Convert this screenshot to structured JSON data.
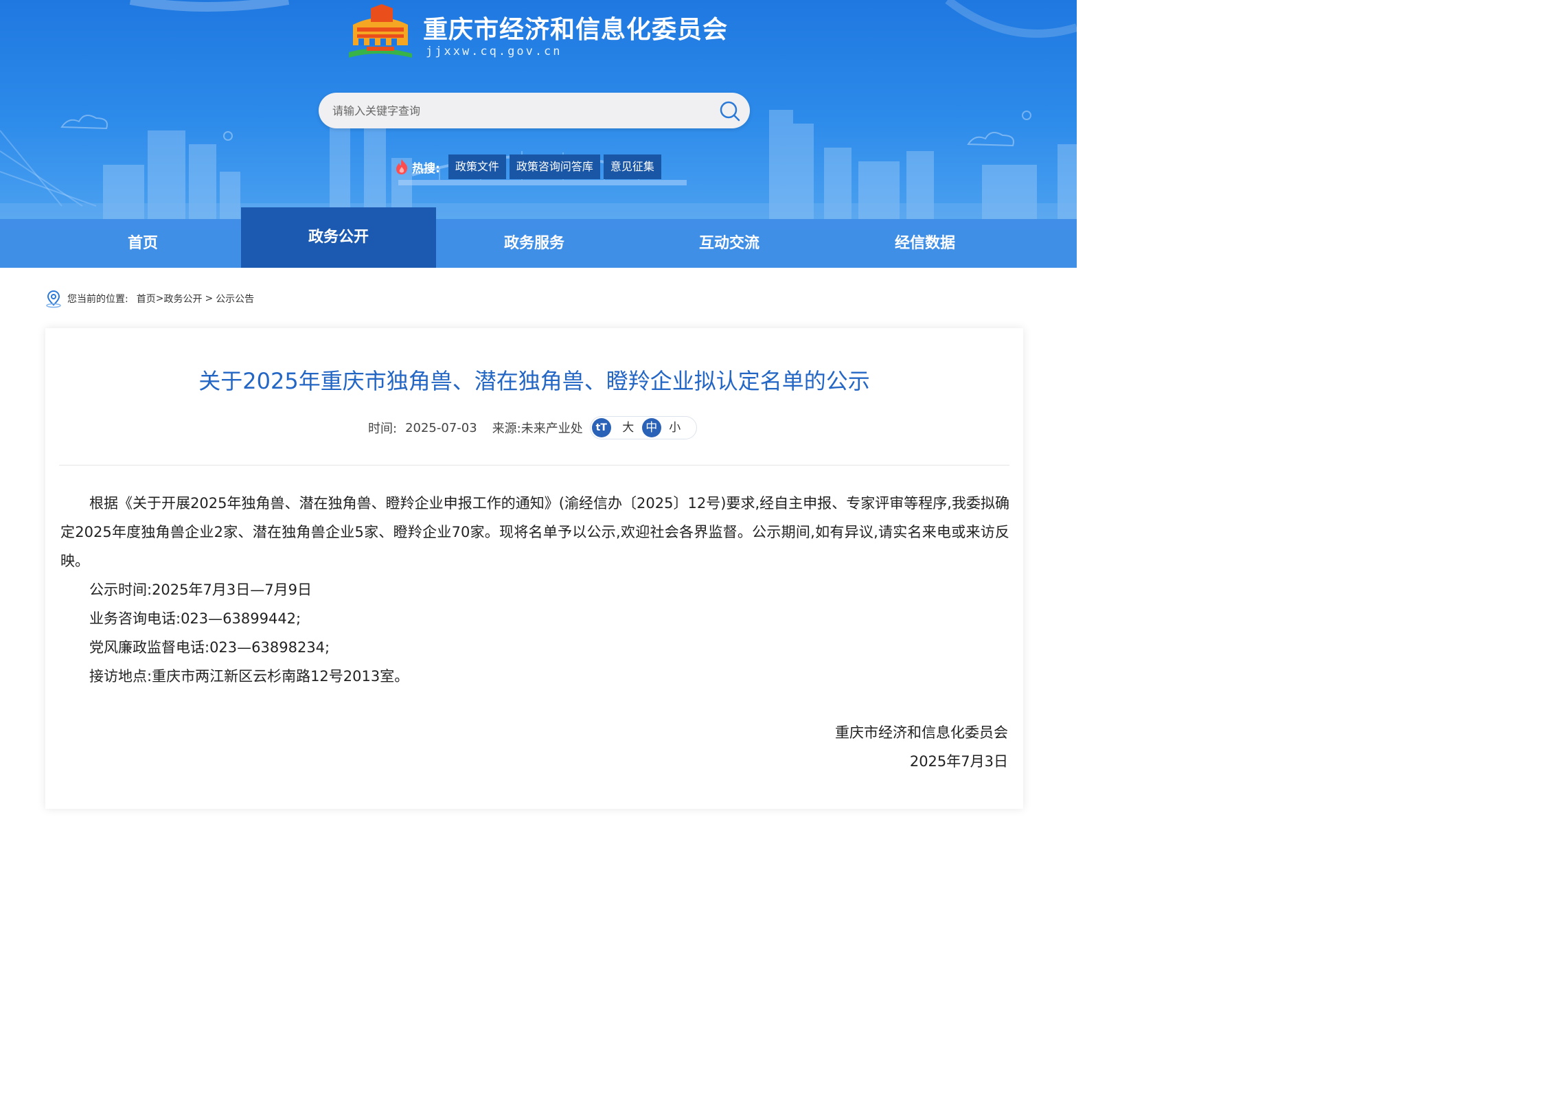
{
  "header": {
    "site_name": "重庆市经济和信息化委员会",
    "site_domain": "jjxxw.cq.gov.cn"
  },
  "search": {
    "placeholder": "请输入关键字查询"
  },
  "hot_search": {
    "label": "热搜:",
    "tags": [
      "政策文件",
      "政策咨询问答库",
      "意见征集"
    ]
  },
  "nav": {
    "items": [
      {
        "label": "首页"
      },
      {
        "label": "政务公开",
        "active": true
      },
      {
        "label": "政务服务"
      },
      {
        "label": "互动交流"
      },
      {
        "label": "经信数据"
      }
    ]
  },
  "breadcrumb": {
    "prefix": "您当前的位置:",
    "path": [
      "首页",
      ">",
      "政务公开",
      ">",
      "公示公告"
    ]
  },
  "article": {
    "title": "关于2025年重庆市独角兽、潜在独角兽、瞪羚企业拟认定名单的公示",
    "meta": {
      "time_label": "时间:",
      "time_value": "2025-07-03",
      "source_label": "来源:",
      "source_value": "未来产业处",
      "font_icon": "tT",
      "font_sizes": [
        "大",
        "中",
        "小"
      ],
      "font_size_selected": "中"
    },
    "paragraphs": [
      "根据《关于开展2025年独角兽、潜在独角兽、瞪羚企业申报工作的通知》(渝经信办〔2025〕12号)要求,经自主申报、专家评审等程序,我委拟确定2025年度独角兽企业2家、潜在独角兽企业5家、瞪羚企业70家。现将名单予以公示,欢迎社会各界监督。公示期间,如有异议,请实名来电或来访反映。",
      "公示时间:2025年7月3日—7月9日",
      "业务咨询电话:023—63899442;",
      "党风廉政监督电话:023—63898234;",
      "接访地点:重庆市两江新区云杉南路12号2013室。"
    ],
    "signature": {
      "org": "重庆市经济和信息化委员会",
      "date": "2025年7月3日"
    }
  },
  "colors": {
    "header_blue": "#2d8bea",
    "nav_active": "#1b5ab0",
    "title_blue": "#2466c4",
    "hot_tag_bg": "#1a56a6"
  }
}
